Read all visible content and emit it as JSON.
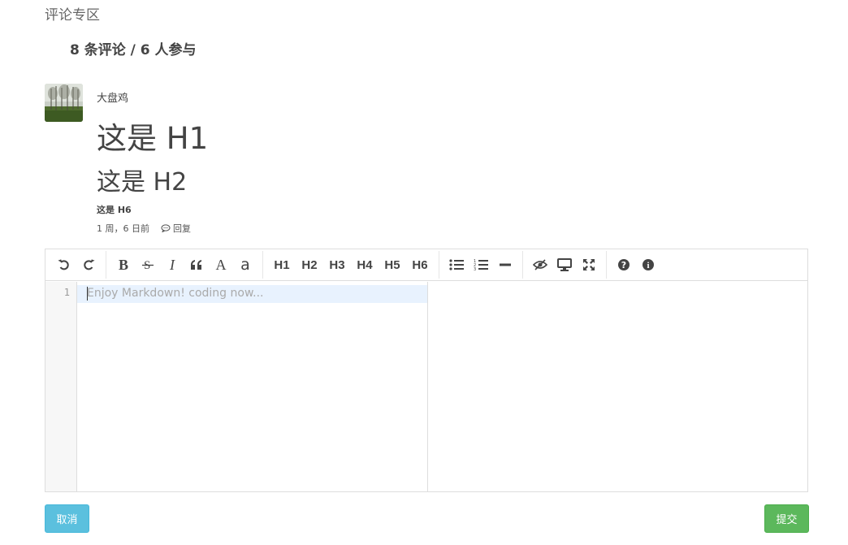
{
  "section_title": "评论专区",
  "comment_count": "8 条评论 / 6 人参与",
  "comment": {
    "author": "大盘鸡",
    "h1": "这是 H1",
    "h2": "这是 H2",
    "h6": "这是 H6",
    "time": "1 周，6 日前",
    "reply": "回复"
  },
  "toolbar": {
    "headings": [
      "H1",
      "H2",
      "H3",
      "H4",
      "H5",
      "H6"
    ],
    "bold": "B",
    "italic": "I",
    "uppercase": "A",
    "lowercase": "a"
  },
  "editor": {
    "line_number": "1",
    "placeholder": "Enjoy Markdown! coding now..."
  },
  "buttons": {
    "cancel": "取消",
    "submit": "提交"
  }
}
